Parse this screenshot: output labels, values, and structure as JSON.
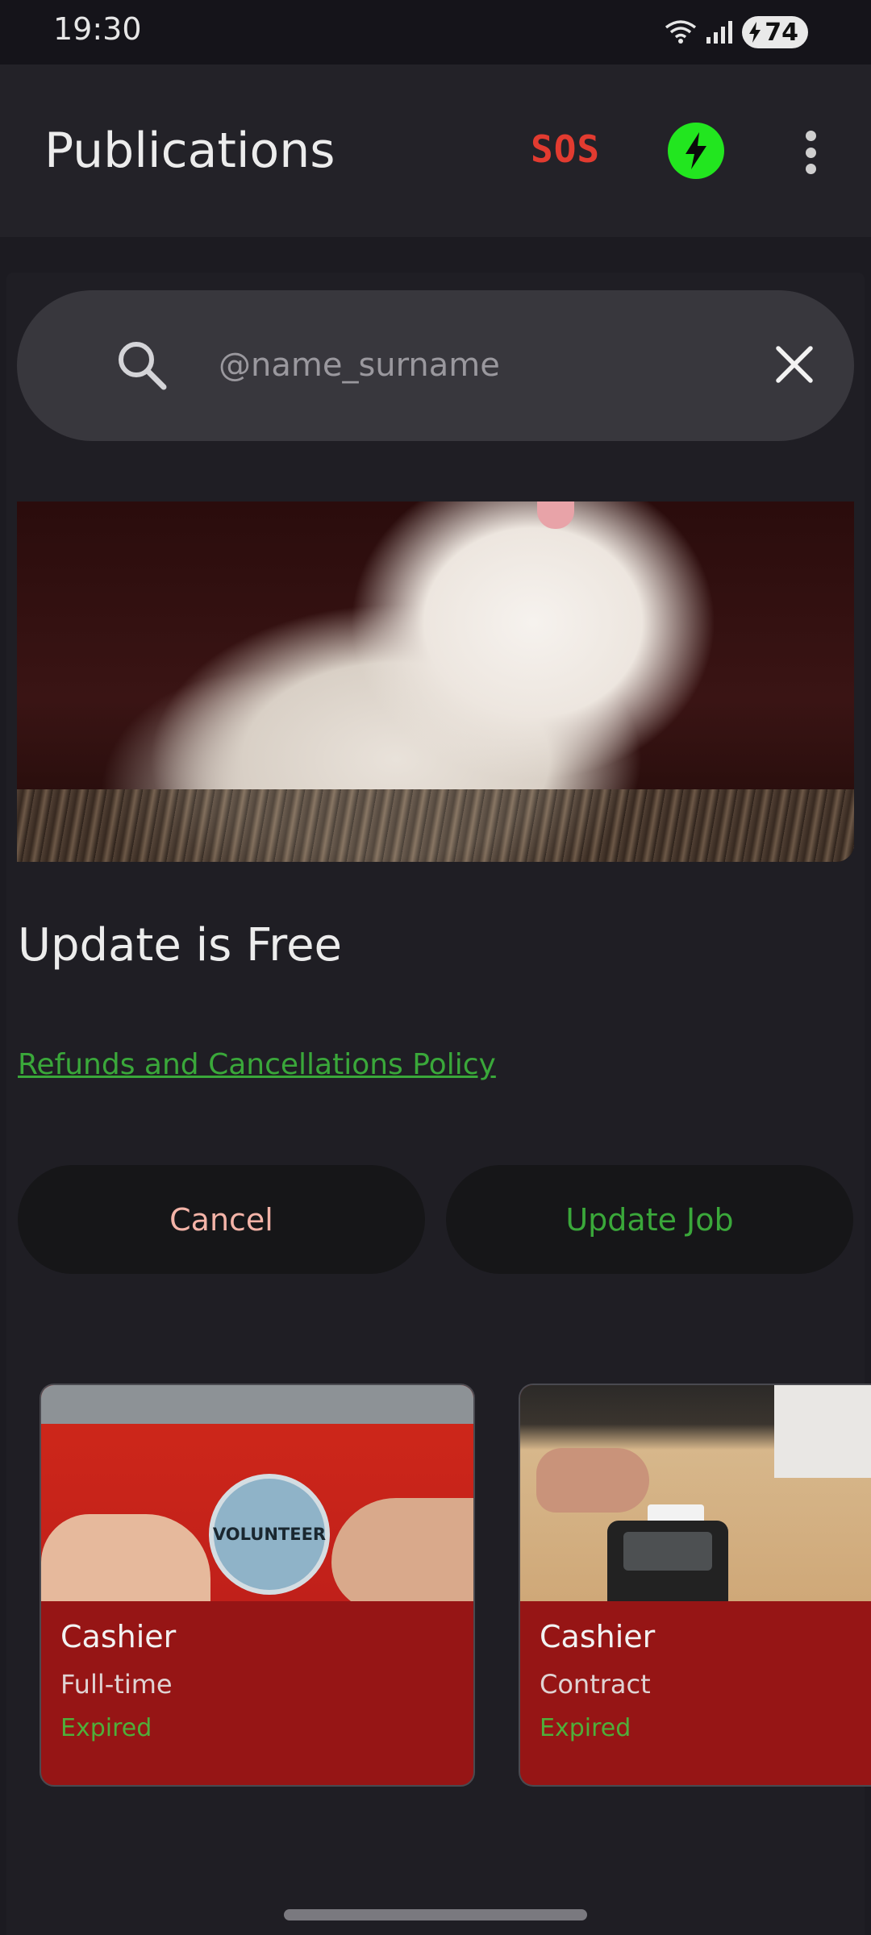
{
  "status_bar": {
    "time": "19:30",
    "battery": "74"
  },
  "app_bar": {
    "title": "Publications",
    "sos_label": "SOS"
  },
  "search": {
    "placeholder": "@name_surname"
  },
  "promo": {
    "title": "Update is Free",
    "policy_link": "Refunds and Cancellations Policy"
  },
  "actions": {
    "cancel_label": "Cancel",
    "update_label": "Update Job"
  },
  "jobs": [
    {
      "title": "Cashier",
      "type": "Full-time",
      "status": "Expired",
      "image_text": "VOLUNTEER"
    },
    {
      "title": "Cashier",
      "type": "Contract",
      "status": "Expired"
    }
  ],
  "colors": {
    "accent_green": "#3aa83a",
    "sos_red": "#e23b30",
    "bolt_green": "#22e61f",
    "card_red": "#961515"
  }
}
